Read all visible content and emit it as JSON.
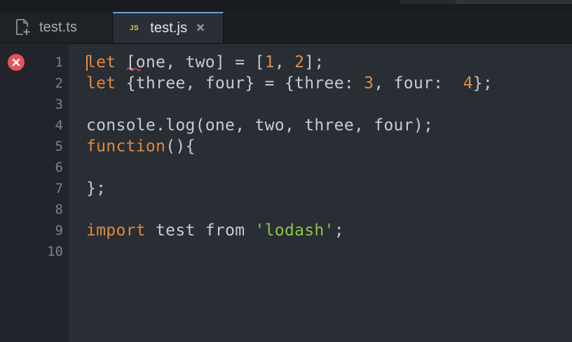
{
  "tabs": [
    {
      "label": "test.ts",
      "active": false,
      "icon": "file-add-icon"
    },
    {
      "label": "test.js",
      "active": true,
      "icon": "js-file-icon",
      "badge": "JS",
      "close": "×"
    }
  ],
  "gutter": {
    "line_numbers": [
      "1",
      "2",
      "3",
      "4",
      "5",
      "6",
      "7",
      "8",
      "9",
      "10"
    ],
    "error_line": 1,
    "error_icon": "error-icon"
  },
  "code": {
    "lines": [
      [
        {
          "t": "let",
          "c": "kw"
        },
        {
          "t": " [one, two] = [",
          "c": ""
        },
        {
          "t": "1",
          "c": "num"
        },
        {
          "t": ", ",
          "c": ""
        },
        {
          "t": "2",
          "c": "num"
        },
        {
          "t": "];",
          "c": ""
        }
      ],
      [
        {
          "t": "let",
          "c": "kw"
        },
        {
          "t": " {three, four} = {three: ",
          "c": ""
        },
        {
          "t": "3",
          "c": "num"
        },
        {
          "t": ", four:  ",
          "c": ""
        },
        {
          "t": "4",
          "c": "num"
        },
        {
          "t": "};",
          "c": ""
        }
      ],
      [],
      [
        {
          "t": "console.log(one, two, three, four);",
          "c": ""
        }
      ],
      [
        {
          "t": "function",
          "c": "kw"
        },
        {
          "t": "(){",
          "c": ""
        }
      ],
      [],
      [
        {
          "t": "};",
          "c": ""
        }
      ],
      [],
      [
        {
          "t": "import",
          "c": "kw"
        },
        {
          "t": " test from ",
          "c": ""
        },
        {
          "t": "'lodash'",
          "c": "str"
        },
        {
          "t": ";",
          "c": ""
        }
      ],
      []
    ]
  },
  "colors": {
    "keyword": "#df8a3c",
    "number": "#e08f3e",
    "string": "#8cc34a",
    "text": "#c7ccd3",
    "accent": "#6ba1dc",
    "error": "#e3545a"
  }
}
